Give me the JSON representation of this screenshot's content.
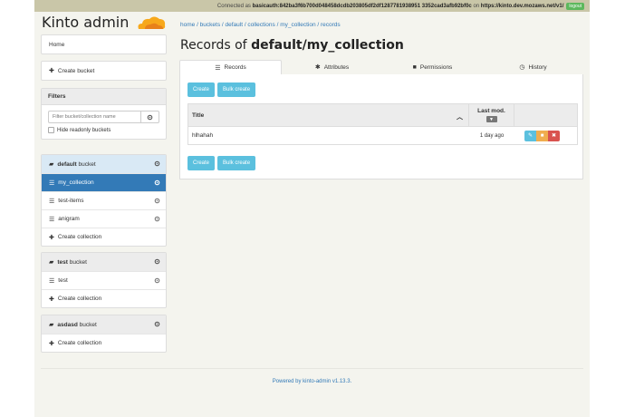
{
  "topbar": {
    "prefix": "Connected as",
    "user": "basicauth:842ba3f6b700d048458dcdb203805df2df1287781938951 3352cad3afb92bf0c",
    "on": "on",
    "server": "https://kinto.dev.mozaws.net/v1/",
    "logout_label": "logout"
  },
  "brand": {
    "title": "Kinto admin"
  },
  "sidebar": {
    "home_label": "Home",
    "create_bucket_label": "Create bucket",
    "filters": {
      "title": "Filters",
      "placeholder": "Filter bucket/collection name",
      "hide_readonly_label": "Hide readonly buckets"
    },
    "buckets": [
      {
        "name": "default",
        "suffix": "bucket",
        "collections": [
          "my_collection",
          "test-items",
          "anigram"
        ],
        "create_label": "Create collection"
      },
      {
        "name": "test",
        "suffix": "bucket",
        "collections": [
          "test"
        ],
        "create_label": "Create collection"
      },
      {
        "name": "asdasd",
        "suffix": "bucket",
        "collections": [],
        "create_label": "Create collection"
      }
    ]
  },
  "breadcrumb": "home / buckets / default / collections / my_collection / records",
  "page_title": {
    "prefix": "Records of",
    "name": "default/my_collection"
  },
  "tabs": [
    {
      "label": "Records",
      "icon": "list-icon"
    },
    {
      "label": "Attributes",
      "icon": "gear-icon"
    },
    {
      "label": "Permissions",
      "icon": "lock-icon"
    },
    {
      "label": "History",
      "icon": "clock-icon"
    }
  ],
  "actions": {
    "create_label": "Create",
    "bulk_label": "Bulk create"
  },
  "table": {
    "headers": {
      "title": "Title",
      "last_mod": "Last mod."
    },
    "rows": [
      {
        "title": "hlhahah",
        "last_mod": "1 day ago"
      }
    ]
  },
  "footer": {
    "prefix": "Powered by",
    "link": "kinto-admin",
    "version": "v1.13.3."
  },
  "colors": {
    "accent": "#337ab7",
    "info": "#5bc0de",
    "warning": "#f0ad4e",
    "danger": "#d9534f",
    "success": "#5cb85c"
  }
}
